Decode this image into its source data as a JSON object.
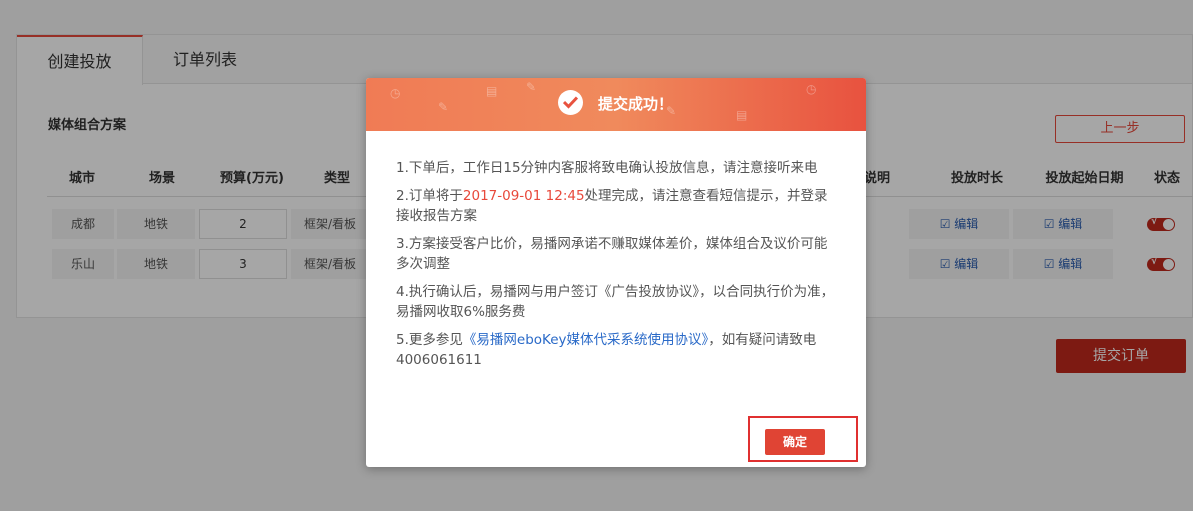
{
  "tabs": {
    "create": "创建投放",
    "orders": "订单列表"
  },
  "section": {
    "title": "媒体组合方案",
    "prev_button": "上一步"
  },
  "table": {
    "headers": [
      "城市",
      "场景",
      "预算(万元)",
      "类型",
      "说明",
      "投放时长",
      "投放起始日期",
      "状态"
    ],
    "rows": [
      {
        "city": "成都",
        "scene": "地铁",
        "budget": "2",
        "type": "框架/看板",
        "duration": "编辑",
        "start": "编辑"
      },
      {
        "city": "乐山",
        "scene": "地铁",
        "budget": "3",
        "type": "框架/看板",
        "duration": "编辑",
        "start": "编辑"
      }
    ]
  },
  "submit_button": "提交订单",
  "modal": {
    "title": "提交成功！",
    "p1": "1.下单后，工作日15分钟内客服将致电确认投放信息，请注意接听来电",
    "p2_before": "2.订单将于",
    "p2_date": "2017-09-01 12:45",
    "p2_after": "处理完成，请注意查看短信提示，并登录接收报告方案",
    "p3": "3.方案接受客户比价，易播网承诺不赚取媒体差价，媒体组合及议价可能多次调整",
    "p4": "4.执行确认后，易播网与用户签订《广告投放协议》，以合同执行价为准，易播网收取6%服务费",
    "p5_before": "5.更多参见",
    "p5_link": "《易播网eboKey媒体代采系统使用协议》",
    "p5_after": "，如有疑问请致电4006061611",
    "confirm": "确定"
  },
  "colors": {
    "accent": "#e8493b",
    "header_gradient_start": "#f07b55",
    "link": "#2a6ac8"
  }
}
